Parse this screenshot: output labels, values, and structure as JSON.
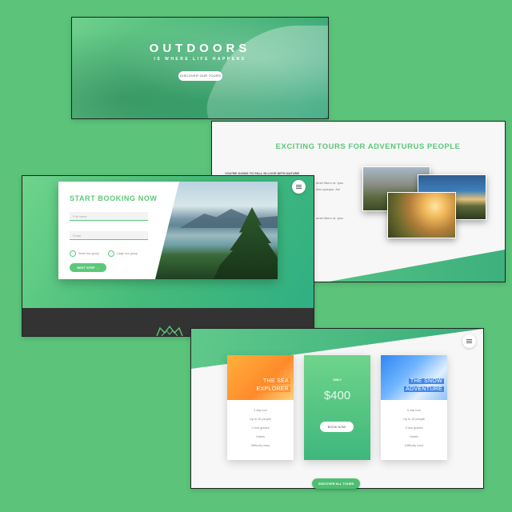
{
  "hero": {
    "title": "OUTDOORS",
    "subtitle": "IS WHERE LIFE HAPPENS",
    "button_label": "DISCOVER OUR TOURS"
  },
  "tours": {
    "title": "EXCITING TOURS FOR ADVENTURUS PEOPLE",
    "subtitle": "YOU'RE GOING TO FALL IN LOVE WITH NATURE",
    "text_lines": [
      "amet libero ut. Ipsu",
      "isus quisque. Aul",
      "amet libero ut. Ipsu"
    ]
  },
  "booking": {
    "title": "START BOOKING NOW",
    "name_placeholder": "Full name",
    "email_placeholder": "Email",
    "option_small": "Small tour group",
    "option_large": "Large tour group",
    "next_button": "NEXT STEP →"
  },
  "cards": {
    "sea": {
      "title_line1": "THE SEA",
      "title_line2": "EXPLORER",
      "features": [
        "3 day tour",
        "Up to 30 people",
        "2 tour guides",
        "Hotels",
        "Difficulty easy"
      ]
    },
    "price_card": {
      "only_label": "ONLY",
      "price": "$400",
      "button": "BOOK NOW"
    },
    "snow": {
      "title_line1": "THE SNOW",
      "title_line2": "ADVENTURE",
      "features": [
        "5 day tour",
        "Up to 15 people",
        "3 tour guides",
        "Hotels",
        "Difficulty hard"
      ]
    },
    "discover_all": "DISCOVER ALL TOURS"
  },
  "colors": {
    "background": "#5bc47a",
    "accent": "#5cc77a",
    "sea_accent": "#ff8a2a",
    "snow_accent": "#2e86f0",
    "dark_band": "#333333"
  }
}
